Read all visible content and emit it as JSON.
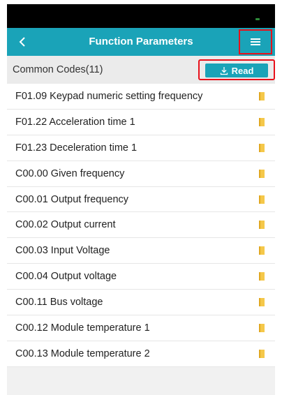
{
  "app_bar": {
    "title": "Function Parameters",
    "back_icon": "chevron-left-icon",
    "menu_icon": "hamburger-menu-icon"
  },
  "subheader": {
    "label": "Common Codes(11)",
    "read_label": "Read",
    "read_icon": "download-icon"
  },
  "colors": {
    "accent": "#1aa3b8",
    "highlight_outline": "#e8101a",
    "bookmark": "#f5c84a",
    "status_bar": "#000000"
  },
  "parameters": [
    "F01.09 Keypad numeric setting frequency",
    "F01.22 Acceleration time 1",
    "F01.23 Deceleration time 1",
    "C00.00 Given frequency",
    "C00.01 Output frequency",
    "C00.02 Output current",
    "C00.03 Input Voltage",
    "C00.04 Output voltage",
    "C00.11 Bus voltage",
    "C00.12 Module temperature 1",
    "C00.13 Module temperature 2"
  ]
}
